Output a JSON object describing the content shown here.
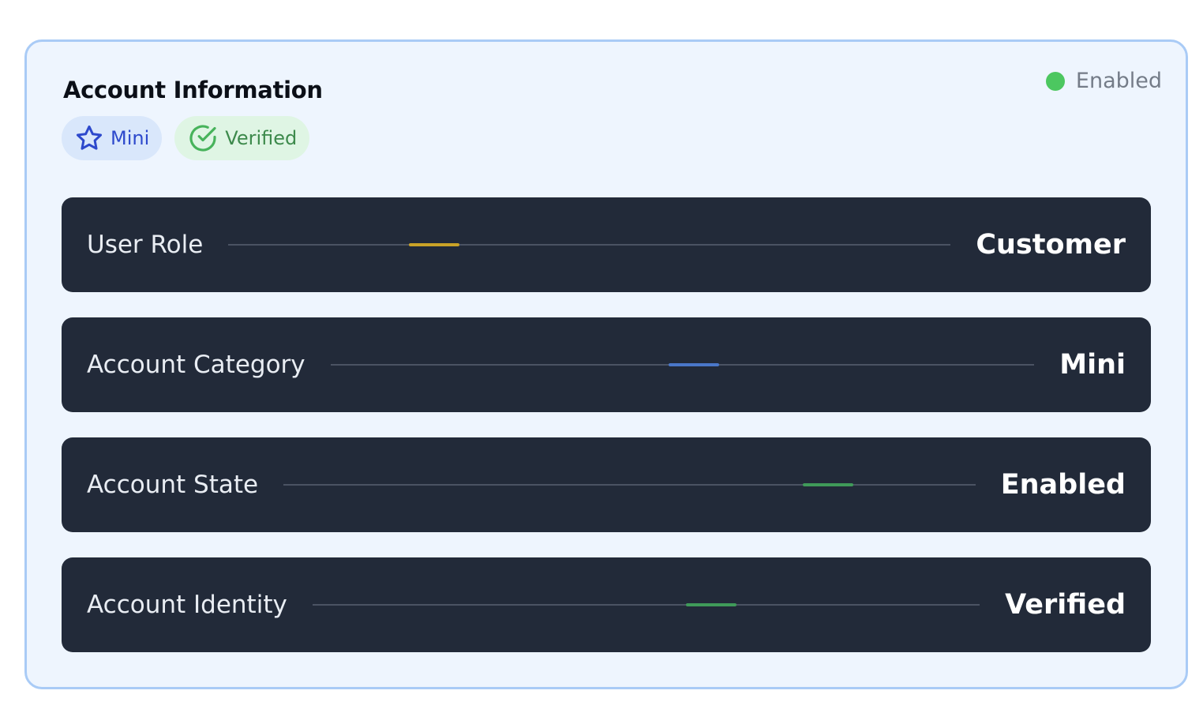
{
  "card": {
    "title": "Account Information",
    "status": {
      "label": "Enabled",
      "color": "#4cc760"
    },
    "badges": [
      {
        "label": "Mini",
        "icon": "star-icon",
        "color": "#2d49cc"
      },
      {
        "label": "Verified",
        "icon": "check-circle-icon",
        "color": "#3d8a4c"
      }
    ]
  },
  "rows": [
    {
      "label": "User Role",
      "value": "Customer",
      "accent_color": "#c9a227"
    },
    {
      "label": "Account Category",
      "value": "Mini",
      "accent_color": "#4a77c9"
    },
    {
      "label": "Account State",
      "value": "Enabled",
      "accent_color": "#3f9a59"
    },
    {
      "label": "Account Identity",
      "value": "Verified",
      "accent_color": "#3f9a59"
    }
  ]
}
